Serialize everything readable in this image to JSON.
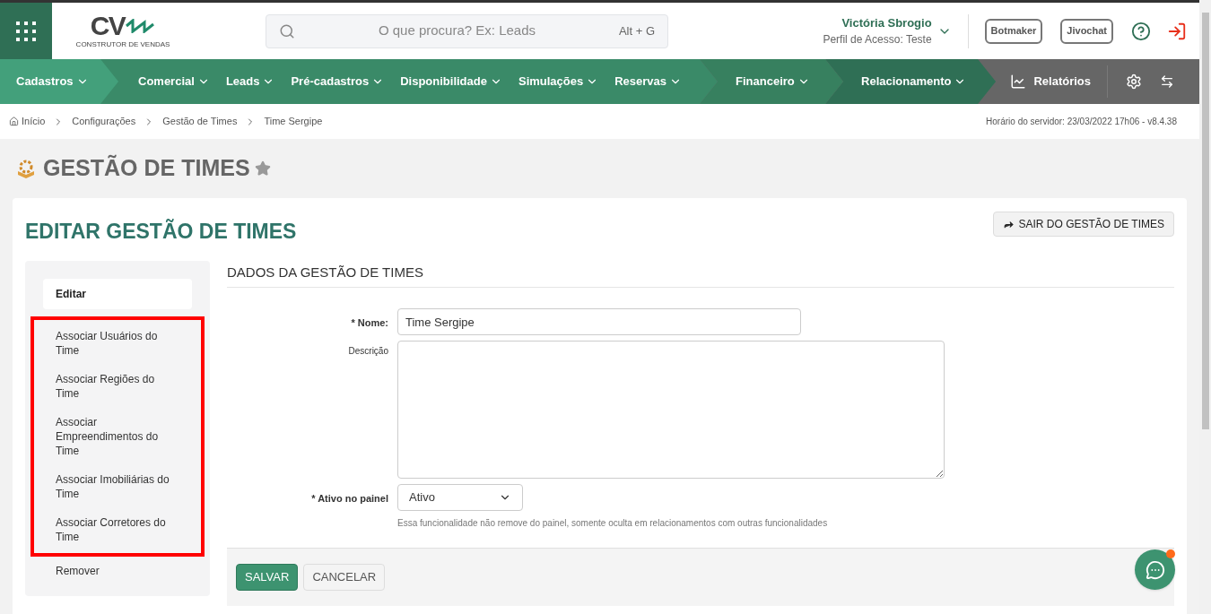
{
  "header": {
    "logo_text": "CV",
    "logo_subtitle": "CONSTRUTOR DE VENDAS",
    "search": {
      "placeholder": "O que procura? Ex: Leads",
      "shortcut": "Alt + G"
    },
    "user": {
      "name": "Victória Sbrogio",
      "profile": "Perfil de Acesso: Teste"
    },
    "buttons": [
      "Botmaker",
      "Jivochat"
    ]
  },
  "nav": {
    "segments": [
      {
        "items": [
          "Cadastros"
        ]
      },
      {
        "items": [
          "Comercial",
          "Leads",
          "Pré-cadastros",
          "Disponibilidade",
          "Simulações",
          "Reservas"
        ]
      },
      {
        "items": [
          "Financeiro"
        ]
      },
      {
        "items": [
          "Relacionamento"
        ]
      }
    ],
    "reports": "Relatórios"
  },
  "breadcrumb": {
    "items": [
      "Início",
      "Configurações",
      "Gestão de Times",
      "Time Sergipe"
    ],
    "server_time": "Horário do servidor: 23/03/2022 17h06 - v8.4.38"
  },
  "page_title": "GESTÃO DE TIMES",
  "favorite": false,
  "card": {
    "title": "EDITAR GESTÃO DE TIMES",
    "exit_button": "SAIR DO GESTÃO DE TIMES",
    "sidebar": [
      {
        "label": "Editar",
        "selected": true,
        "highlighted": false
      },
      {
        "label": "Associar Usuários do Time",
        "selected": false,
        "highlighted": true
      },
      {
        "label": "Associar Regiões do Time",
        "selected": false,
        "highlighted": true
      },
      {
        "label": "Associar Empreendimentos do Time",
        "selected": false,
        "highlighted": true
      },
      {
        "label": "Associar Imobiliárias do Time",
        "selected": false,
        "highlighted": true
      },
      {
        "label": "Associar Corretores do Time",
        "selected": false,
        "highlighted": true
      },
      {
        "label": "Remover",
        "selected": false,
        "highlighted": false
      }
    ],
    "section_title": "DADOS DA GESTÃO DE TIMES",
    "form": {
      "name": {
        "label": "* Nome:",
        "value": "Time Sergipe"
      },
      "description": {
        "label": "Descrição"
      },
      "active": {
        "label": "* Ativo no painel",
        "value": "Ativo",
        "hint": "Essa funcionalidade não remove do painel, somente oculta em relacionamentos com outras funcionalidades"
      }
    },
    "actions": {
      "save": "SALVAR",
      "cancel": "CANCELAR"
    }
  },
  "chat_notification": true
}
